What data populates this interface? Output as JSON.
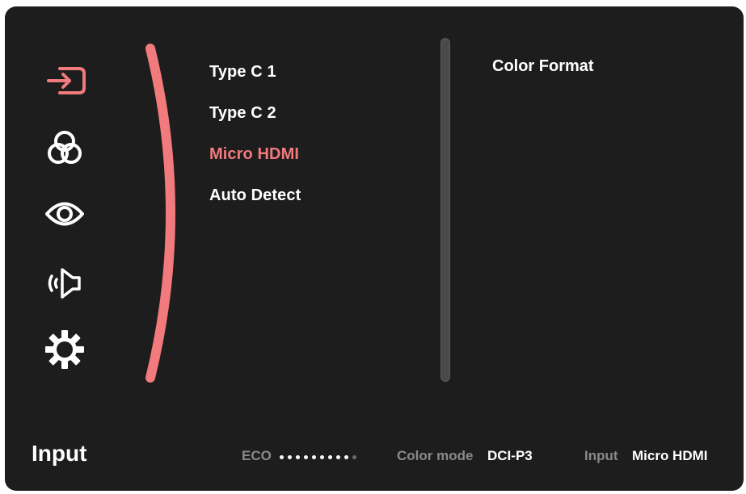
{
  "menu": {
    "items": [
      {
        "label": "Type C 1",
        "selected": false
      },
      {
        "label": "Type C 2",
        "selected": false
      },
      {
        "label": "Micro HDMI",
        "selected": true
      },
      {
        "label": "Auto Detect",
        "selected": false
      }
    ]
  },
  "submenu": {
    "title": "Color Format"
  },
  "sidebar": {
    "icons": [
      "input-icon",
      "color-icon",
      "eye-icon",
      "audio-icon",
      "settings-icon"
    ],
    "active": "input-icon"
  },
  "footer": {
    "title": "Input",
    "eco_label": "ECO",
    "eco_level": 9,
    "eco_total": 10,
    "color_mode_label": "Color mode",
    "color_mode_value": "DCI-P3",
    "input_label": "Input",
    "input_value": "Micro HDMI"
  },
  "colors": {
    "accent": "#f07a7c",
    "background": "#1d1d1d",
    "text": "#ffffff",
    "muted": "#8a8a8a"
  }
}
